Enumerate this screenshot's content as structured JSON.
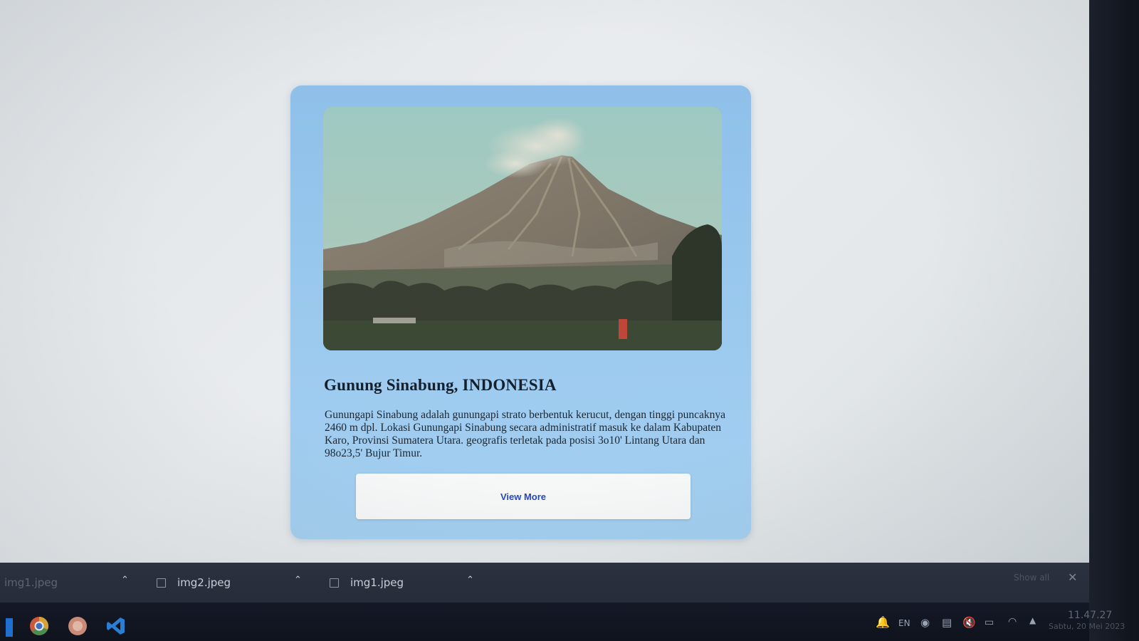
{
  "card": {
    "title": "Gunung Sinabung, INDONESIA",
    "description": "Gunungapi Sinabung adalah gunungapi strato berbentuk kerucut, dengan tinggi puncaknya 2460 m dpl. Lokasi Gunungapi Sinabung secara administratif masuk ke dalam Kabupaten Karo, Provinsi Sumatera Utara. geografis terletak pada posisi 3o10' Lintang Utara dan 98o23,5' Bujur Timur.",
    "button_label": "View More",
    "image_icon": "volcano-photo",
    "background_color": "#9ccaef",
    "button_text_color": "#2546b8"
  },
  "downloads": {
    "items": [
      {
        "name": "img1.jpeg",
        "faded": true
      },
      {
        "name": "img2.jpeg",
        "faded": false
      },
      {
        "name": "img1.jpeg",
        "faded": false
      }
    ],
    "show_all_label": "Show all",
    "close_icon": "close-icon"
  },
  "taskbar": {
    "apps": [
      "chrome-icon",
      "app-icon",
      "vscode-icon"
    ],
    "tray": {
      "language": "EN",
      "icons": [
        "notification-icon",
        "language-indicator",
        "network-icon",
        "clipboard-icon",
        "volume-muted-icon",
        "battery-icon",
        "wifi-icon",
        "tray-expand-icon"
      ]
    },
    "clock": {
      "time": "11.47.27",
      "date": "Sabtu, 20 Mei 2023"
    }
  }
}
